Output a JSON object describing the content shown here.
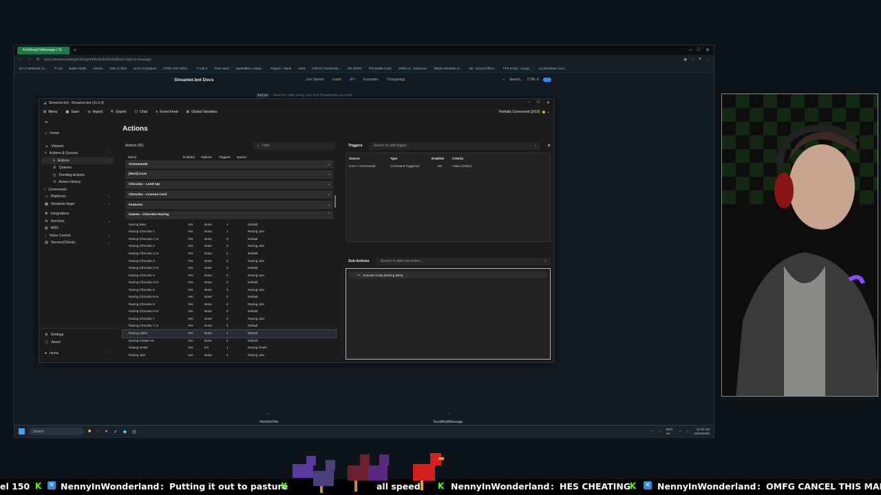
{
  "browser": {
    "tab_title": "KickReplyToMessage | St",
    "url": "docs.streamer.bot/api/csharp/methods/kick/chat/kick-reply-to-message",
    "bookmarks": [
      "All C# Methods | S...",
      "P List",
      "Battle Fields",
      "Resize",
      "OBJ to SDS",
      "Echo-3 Dropbox",
      "FFRK OST Elio's...",
      "P List 2",
      "Pass Vault",
      "MyWelfare, Depar...",
      "Paypal + Bank",
      "AWS",
      "KOFXV Sound Mo...",
      "RE ZERO",
      "FF8 Battle Code",
      "KREA AI - Enhancer",
      "8Bitdo Wireless U...",
      "VB - Sound Effect...",
      "FF9 Script - Googl...",
      "L0 UltraGear Curv..."
    ]
  },
  "docs": {
    "logo": "Streamer.bot Docs",
    "nav": [
      "Get Started",
      "Guide",
      "API",
      "Examples",
      "Changelogs"
    ],
    "search": "Search...",
    "search_kbd": "CTRL K",
    "hint_code": "false",
    "hint_text": "- Send the reply using your Kick Broadcaster account",
    "prev_label": "KickSetTitle",
    "next_label": "SendKickMessage"
  },
  "app": {
    "title": "Streamer.bot - Streamer.bot (v1.0.4)",
    "menu": [
      "Menu",
      "Save",
      "Import",
      "Export",
      "Chat",
      "Event Feed",
      "Global Variables"
    ],
    "connection": "Partially Connected (9/10)",
    "sidebar": {
      "items": [
        "Home",
        "Viewers",
        "Actions & Queues",
        "Actions",
        "Queues",
        "Pending Actions",
        "Action History",
        "Commands",
        "Platforms",
        "Streamer Apps",
        "Integrations",
        "Services",
        "MIDI",
        "Voice Control",
        "Servers/Clients"
      ],
      "bottom": [
        "Settings",
        "About",
        "tsuna"
      ]
    },
    "page_title": "Actions",
    "actions": {
      "header": "Actions (81)",
      "filter_placeholder": "Filter",
      "columns": [
        "Name",
        "Enabled",
        "Options",
        "Triggers",
        "Queue"
      ],
      "groups": [
        "!Commands",
        "[Host] Core",
        "Chocobo - Level Up",
        "Chocobo - License Card",
        "Features",
        "Games - Chocobo Racing"
      ],
      "rows": [
        [
          "Racing Bets",
          "Yes",
          "None",
          "1",
          "Default"
        ],
        [
          "Racing Chocobo 1",
          "Yes",
          "None",
          "1",
          "Racing Join"
        ],
        [
          "Racing Chocobo 1 AI",
          "Yes",
          "None",
          "0",
          "Default"
        ],
        [
          "Racing Chocobo 2",
          "Yes",
          "None",
          "0",
          "Racing Join"
        ],
        [
          "Racing Chocobo 2 AI",
          "Yes",
          "None",
          "0",
          "Default"
        ],
        [
          "Racing Chocobo 3",
          "Yes",
          "None",
          "0",
          "Racing Join"
        ],
        [
          "Racing Chocobo 3 AI",
          "Yes",
          "None",
          "0",
          "Default"
        ],
        [
          "Racing Chocobo 4",
          "Yes",
          "None",
          "0",
          "Racing Join"
        ],
        [
          "Racing Chocobo 4 AI",
          "Yes",
          "None",
          "0",
          "Default"
        ],
        [
          "Racing Chocobo 5",
          "Yes",
          "None",
          "0",
          "Racing Join"
        ],
        [
          "Racing Chocobo 5 AI",
          "Yes",
          "None",
          "0",
          "Default"
        ],
        [
          "Racing Chocobo 6",
          "Yes",
          "None",
          "0",
          "Racing Join"
        ],
        [
          "Racing Chocobo 6 AI",
          "Yes",
          "None",
          "0",
          "Default"
        ],
        [
          "Racing Chocobo 7",
          "Yes",
          "None",
          "0",
          "Racing Join"
        ],
        [
          "Racing Chocobo 7 AI",
          "Yes",
          "None",
          "0",
          "Default"
        ],
        [
          "Racing Claim",
          "Yes",
          "None",
          "1",
          "Default"
        ],
        [
          "Racing Create Ais",
          "Yes",
          "None",
          "0",
          "Default"
        ],
        [
          "Racing Finish",
          "Yes",
          "EX",
          "1",
          "Racing Finish"
        ],
        [
          "Racing Join",
          "Yes",
          "None",
          "1",
          "Racing Join"
        ]
      ],
      "highlight_index": 15
    },
    "triggers": {
      "label": "Triggers",
      "search_placeholder": "Search to add trigger...",
      "columns": [
        "Source",
        "Type",
        "Enabled",
        "Criteria"
      ],
      "row": [
        "Core > Commands",
        "Command Triggered",
        "Yes",
        "!claim (!claim)"
      ]
    },
    "subactions": {
      "label": "Sub-Actions",
      "search_placeholder": "Search to add sub-action...",
      "item": "Execute Code (Racing Bets)"
    }
  },
  "taskbar": {
    "search": "Search",
    "lang": "ENG",
    "region": "UK",
    "time": "12:30 AM",
    "date": "10/03/2026"
  },
  "ticker": {
    "segments": [
      "el 150",
      "NennyInWonderland",
      ":",
      "Putting it out to pasture",
      "all speed",
      "NennyInWonderland",
      ":",
      "HES CHEATING",
      "NennyInWonderland",
      ":",
      "OMFG CANCEL THIS MAN"
    ]
  },
  "colors": {
    "accent": "#3fa0ff",
    "kick_green": "#53fc18",
    "connection_dot": "#e0c000"
  }
}
